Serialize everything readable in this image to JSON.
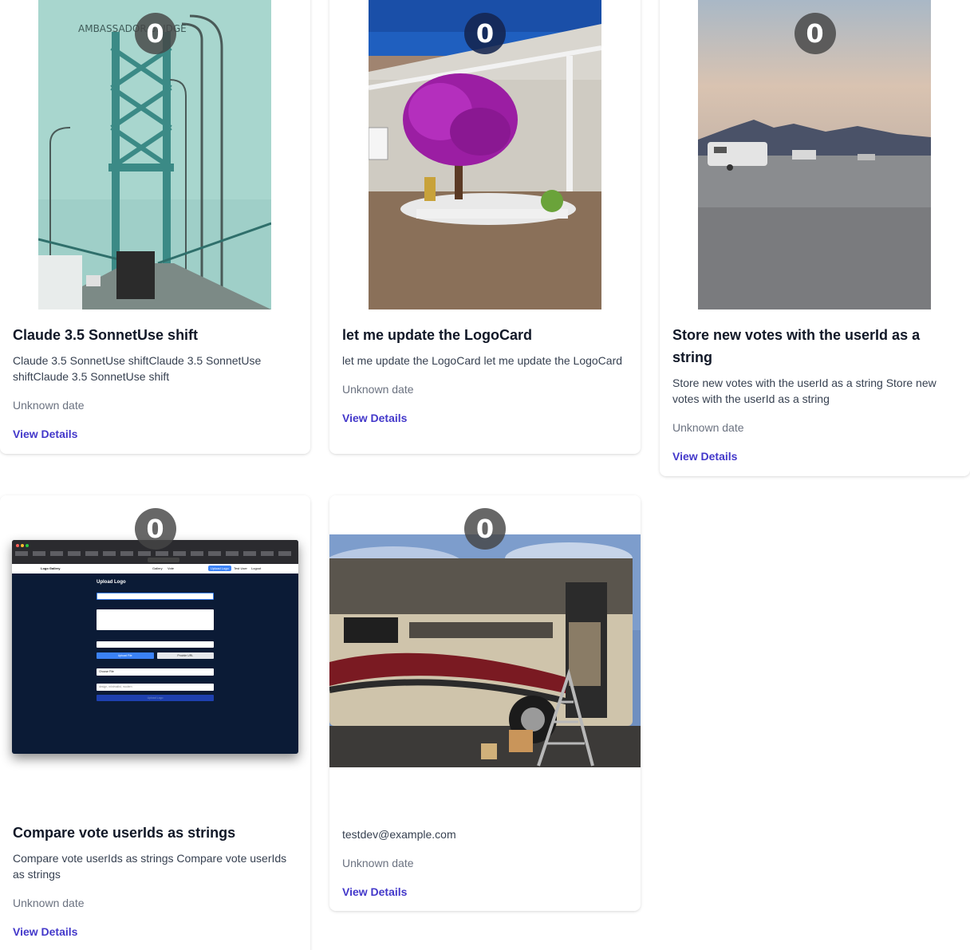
{
  "cards": [
    {
      "votes": "0",
      "title": "Claude 3.5 SonnetUse shift",
      "description": "Claude 3.5 SonnetUse shiftClaude 3.5 SonnetUse shiftClaude 3.5 SonnetUse shift",
      "date": "Unknown date",
      "link": "View Details",
      "image_text": "AMBASSADOR BRIDGE"
    },
    {
      "votes": "0",
      "title": "let me update the LogoCard",
      "description": "let me update the LogoCard let me update the LogoCard",
      "date": "Unknown date",
      "link": "View Details"
    },
    {
      "votes": "0",
      "title": "Store new votes with the userId as a string",
      "description": "Store new votes with the userId as a string Store new votes with the userId as a string",
      "date": "Unknown date",
      "link": "View Details"
    },
    {
      "votes": "0",
      "title": "Compare vote userIds as strings",
      "description": "Compare vote userIds as strings Compare vote userIds as strings",
      "date": "Unknown date",
      "link": "View Details",
      "screenshot": {
        "app_name": "Logo Gallery",
        "nav_gallery": "Gallery",
        "nav_vote": "Vote",
        "upload_button": "Upload Logo",
        "user": "Test User",
        "logout": "Logout",
        "heading": "Upload Logo",
        "upload_file": "Upload File",
        "provide_url": "Provide URL",
        "choose_file": "Choose File",
        "tags_placeholder": "design, minimalist, modern",
        "submit": "Upload Logo"
      }
    },
    {
      "votes": "0",
      "email": "testdev@example.com",
      "date": "Unknown date",
      "link": "View Details"
    }
  ],
  "colors": {
    "link": "#4338ca",
    "badge": "#464646",
    "badge_dark": "#142650"
  }
}
